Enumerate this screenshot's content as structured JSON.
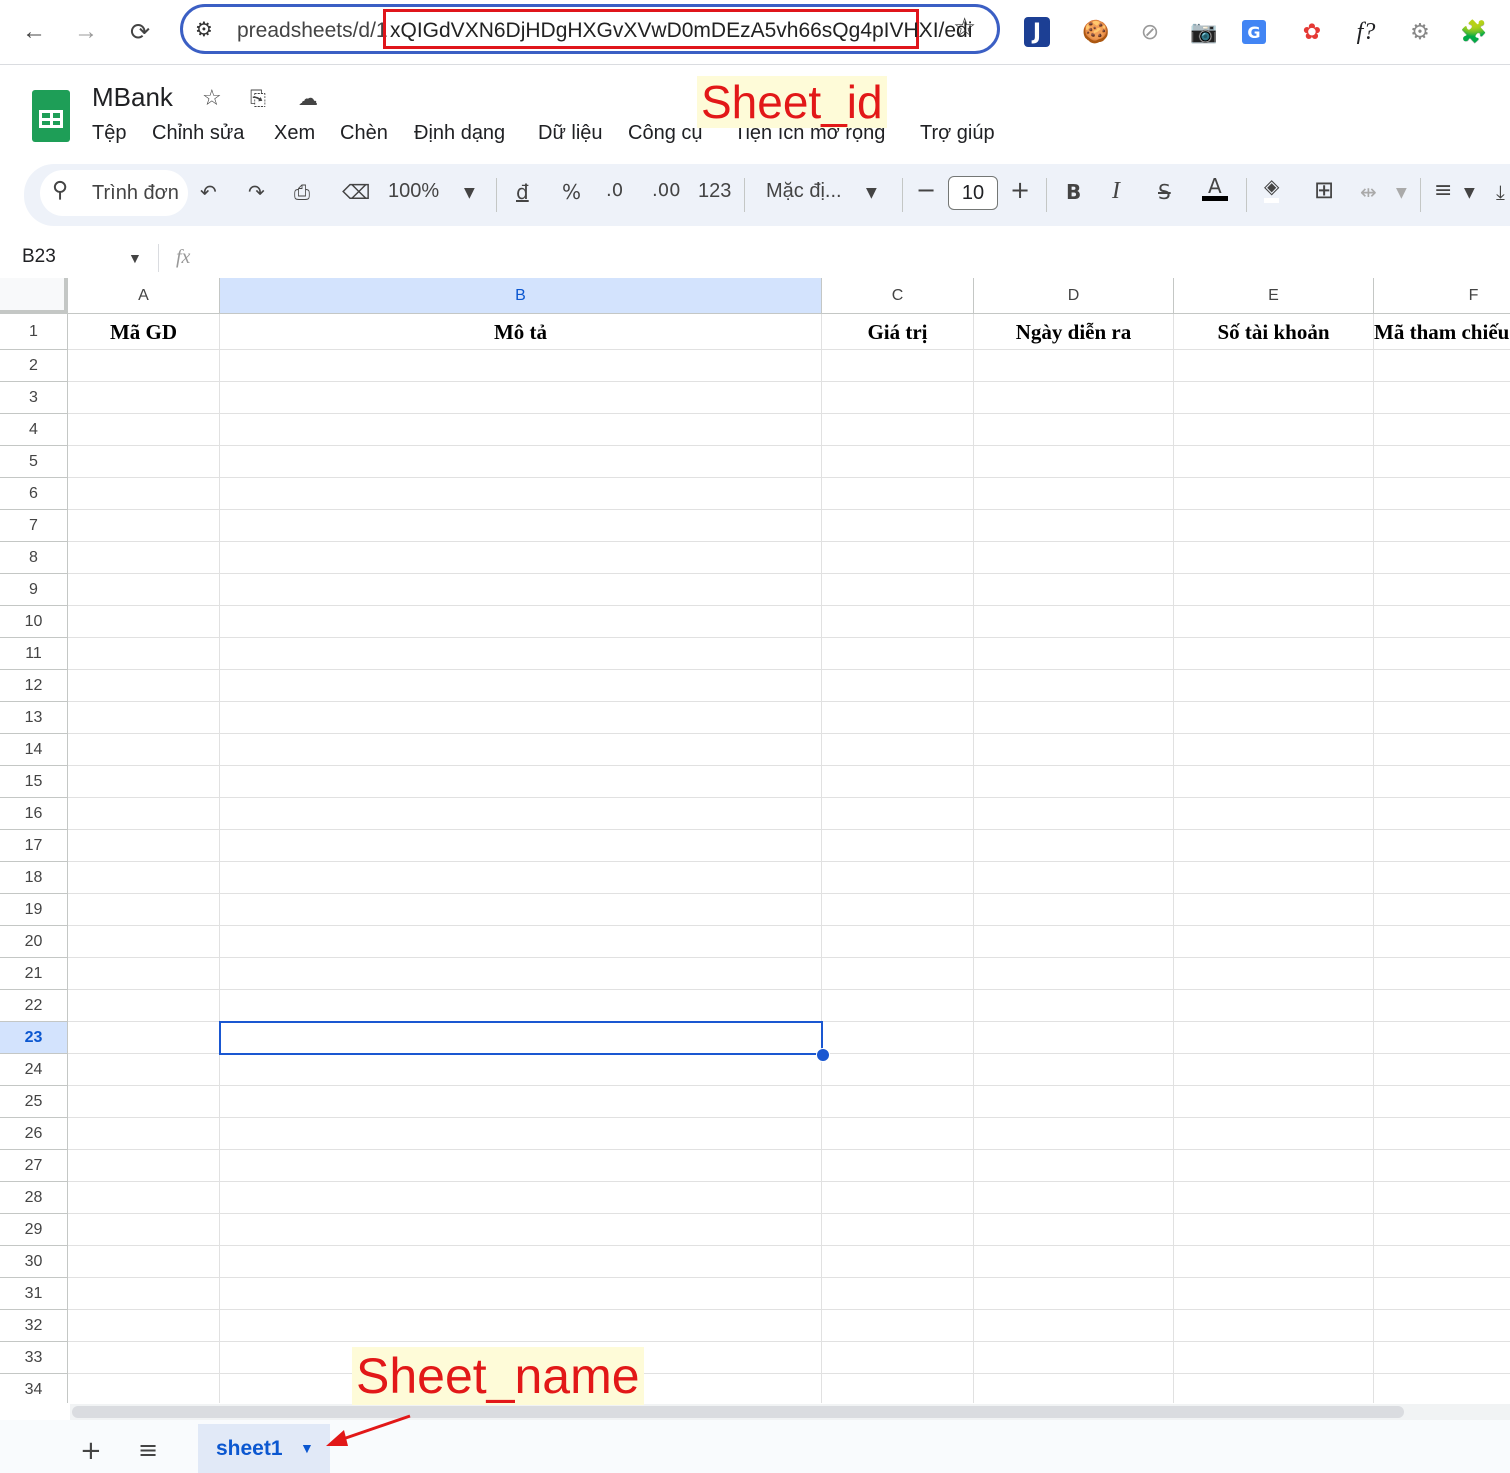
{
  "browser": {
    "url_prefix": "preadsheets/d/1",
    "url_id": "xQIGdVXN6DjHDgHXGvXVwD0mDEzA5vh66sQg4pIVHXI/edi",
    "back": "←",
    "forward": "→",
    "reload": "⟳",
    "extensions": [
      "J",
      "🍪",
      "⊘",
      "📷",
      "G",
      "✿",
      "f?",
      "⚙",
      "🧩"
    ]
  },
  "doc": {
    "title": "MBank",
    "menu": [
      "Tệp",
      "Chỉnh sửa",
      "Xem",
      "Chèn",
      "Định dạng",
      "Dữ liệu",
      "Công cụ",
      "Tiện ích mở rộng",
      "Trợ giúp"
    ]
  },
  "annotations": {
    "sheet_id": "Sheet_id",
    "sheet_name": "Sheet_name"
  },
  "toolbar": {
    "search_placeholder": "Trình đơn",
    "zoom": "100%",
    "currency": "đ",
    "percent": "%",
    "dec_decrease": ".0",
    "dec_increase": ".00",
    "number_format": "123",
    "font": "Mặc đị...",
    "font_size": "10",
    "bold": "B",
    "italic": "I",
    "strike": "S",
    "text_color": "A"
  },
  "formula_bar": {
    "name_box": "B23",
    "fx": "fx",
    "value": ""
  },
  "grid": {
    "columns": [
      "A",
      "B",
      "C",
      "D",
      "E",
      "F"
    ],
    "header_row": [
      "Mã GD",
      "Mô tả",
      "Giá trị",
      "Ngày diễn ra",
      "Số tài khoản",
      "Mã tham chiếu"
    ],
    "row_count": 34,
    "active_cell": "B23",
    "active_column": "B",
    "active_row": 23
  },
  "sheets": {
    "tabs": [
      "sheet1"
    ],
    "active": "sheet1"
  },
  "colors": {
    "accent": "#1a57d1",
    "annotation": "#e21818",
    "sheets_green": "#1e9e57"
  }
}
